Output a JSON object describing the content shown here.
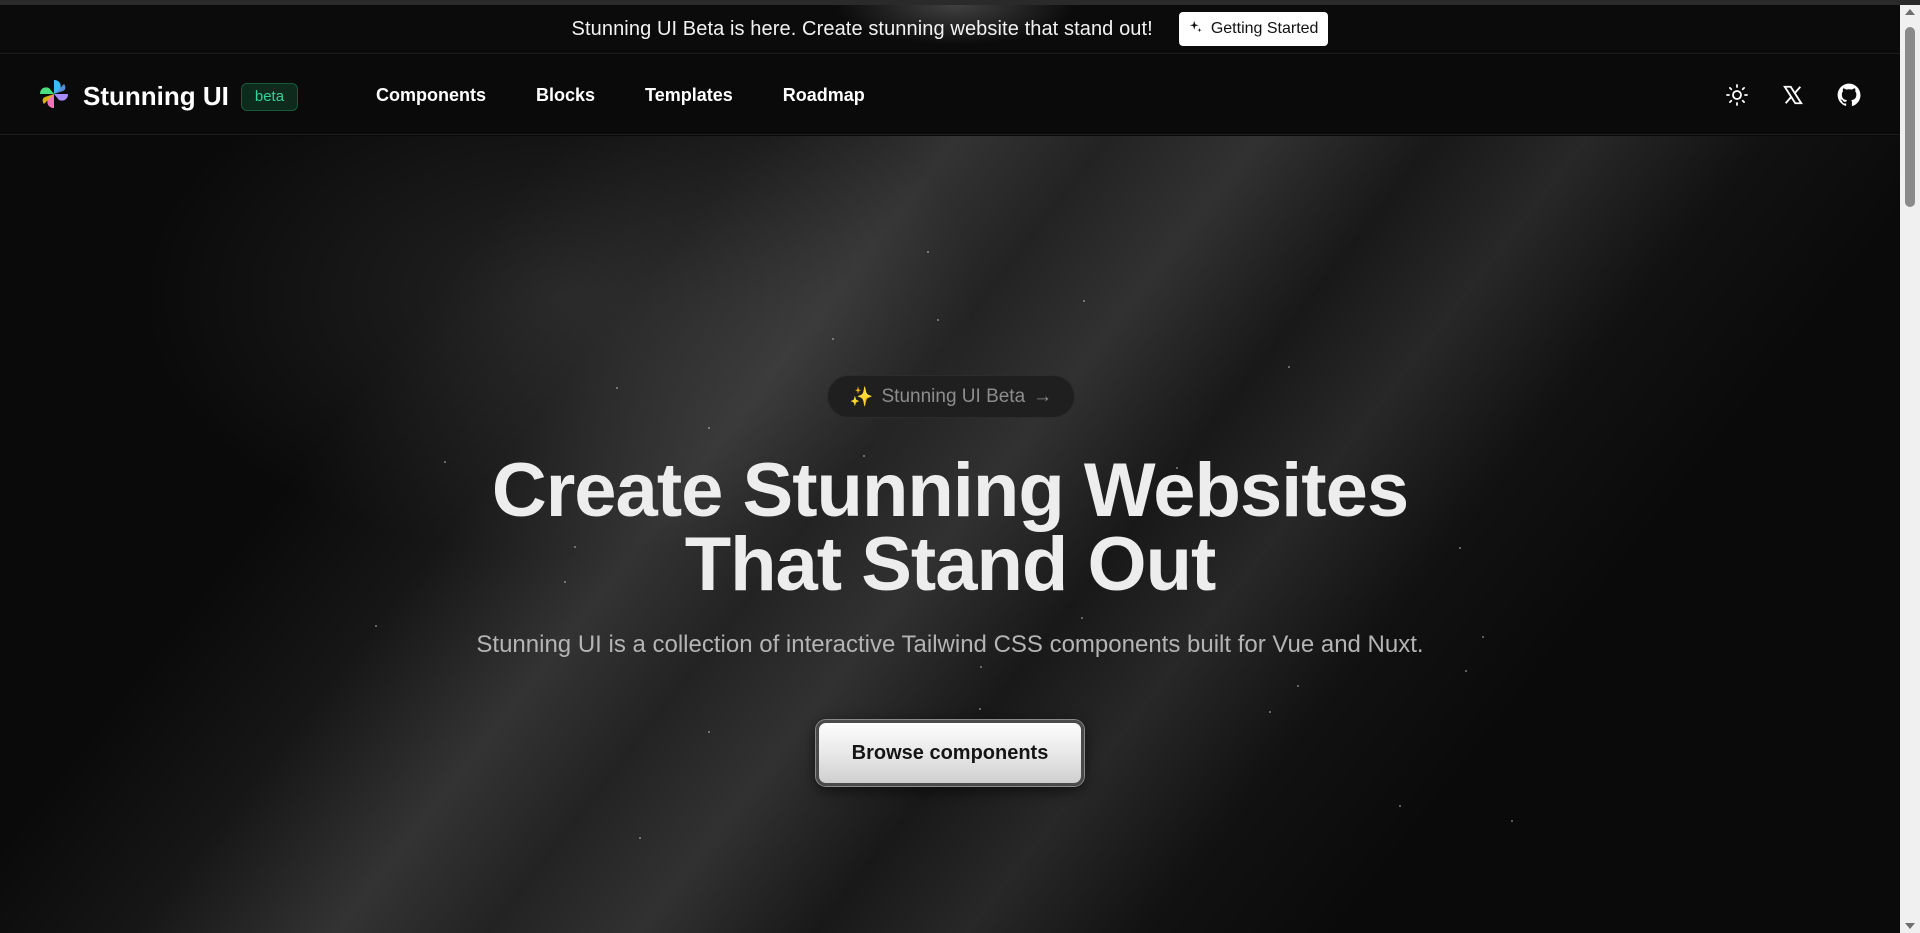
{
  "announcement": {
    "text": "Stunning UI Beta is here. Create stunning website that stand out!",
    "cta_label": "Getting Started",
    "cta_icon": "sparkle-icon"
  },
  "header": {
    "brand_name": "Stunning UI",
    "badge": "beta",
    "logo_icon": "stunning-ui-logo",
    "nav": [
      {
        "label": "Components"
      },
      {
        "label": "Blocks"
      },
      {
        "label": "Templates"
      },
      {
        "label": "Roadmap"
      }
    ],
    "icons": [
      "sun-icon",
      "x-icon",
      "github-icon"
    ]
  },
  "hero": {
    "pill_emoji": "✨",
    "pill_label": "Stunning UI Beta",
    "pill_arrow": "→",
    "title_line1": "Create Stunning Websites",
    "title_line2": "That Stand Out",
    "subtitle": "Stunning UI is a collection of interactive Tailwind CSS components built for Vue and Nuxt.",
    "button_label": "Browse components"
  },
  "colors": {
    "background": "#0a0a0a",
    "badge_text": "#34d399",
    "badge_bg": "#0d2a1d",
    "title": "#ededed",
    "subtitle": "#b4b4b4"
  }
}
